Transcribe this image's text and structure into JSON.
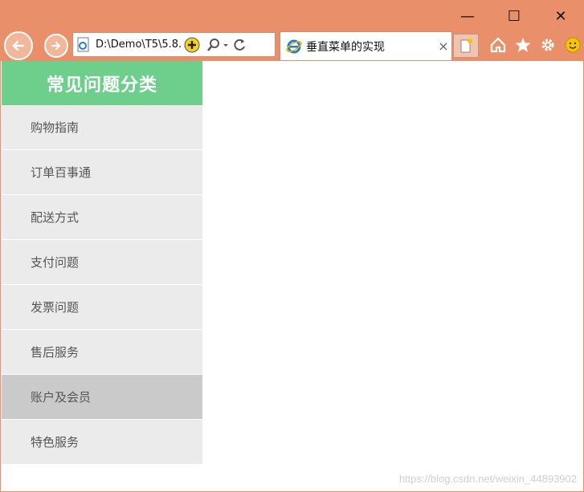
{
  "window": {
    "controls": [
      {
        "name": "minimize-button",
        "glyph": "—"
      },
      {
        "name": "maximize-button",
        "glyph": "☐"
      },
      {
        "name": "close-button",
        "glyph": "✕"
      }
    ]
  },
  "address_bar": {
    "url": "D:\\Demo\\T5\\5.8."
  },
  "tab": {
    "title": "垂直菜单的实现",
    "close": "×"
  },
  "menu": {
    "title": "常见问题分类",
    "items": [
      {
        "label": "购物指南",
        "hover": false
      },
      {
        "label": "订单百事通",
        "hover": false
      },
      {
        "label": "配送方式",
        "hover": false
      },
      {
        "label": "支付问题",
        "hover": false
      },
      {
        "label": "发票问题",
        "hover": false
      },
      {
        "label": "售后服务",
        "hover": false
      },
      {
        "label": "账户及会员",
        "hover": true
      },
      {
        "label": "特色服务",
        "hover": false
      }
    ]
  },
  "watermark": "https://blog.csdn.net/weixin_44893902",
  "colors": {
    "chrome": "#e9906a",
    "menu_header": "#6dcf8b",
    "menu_item": "#ebebeb",
    "menu_item_hover": "#cbcaca"
  },
  "icons": [
    "back-icon",
    "forward-icon",
    "ie-page-icon",
    "add-icon",
    "search-icon",
    "dropdown-icon",
    "refresh-icon",
    "ie-logo-icon",
    "new-tab-icon",
    "home-icon",
    "favorites-star-icon",
    "gear-icon",
    "smiley-icon"
  ]
}
